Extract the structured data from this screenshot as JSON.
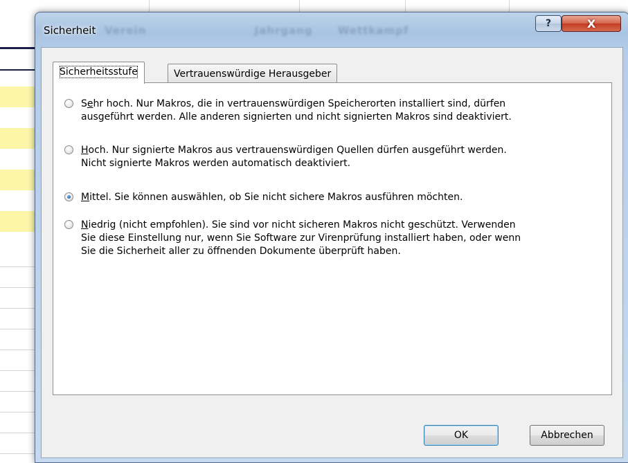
{
  "background_headers": [
    "Verein",
    "Jahrgang",
    "Wettkampf"
  ],
  "dialog": {
    "title": "Sicherheit",
    "help_glyph": "?",
    "close_glyph": "X",
    "tabs": [
      {
        "label": "Sicherheitsstufe",
        "active": true
      },
      {
        "label": "Vertrauenswürdige Herausgeber",
        "active": false
      }
    ],
    "options": [
      {
        "key_letter": "e",
        "pre": "S",
        "post": "hr hoch. Nur Makros, die in vertrauenswürdigen Speicherorten installiert sind, dürfen\nausgeführt werden. Alle anderen signierten und nicht signierten Makros sind deaktiviert.",
        "checked": false
      },
      {
        "key_letter": "H",
        "pre": "",
        "post": "och. Nur signierte Makros aus vertrauenswürdigen Quellen dürfen ausgeführt werden.\nNicht signierte Makros werden automatisch deaktiviert.",
        "checked": false
      },
      {
        "key_letter": "M",
        "pre": "",
        "post": "ittel. Sie können auswählen, ob Sie nicht sichere Makros ausführen möchten.",
        "checked": true
      },
      {
        "key_letter": "N",
        "pre": "",
        "post": "iedrig (nicht empfohlen). Sie sind vor nicht sicheren Makros nicht geschützt. Verwenden\nSie diese Einstellung nur, wenn Sie Software zur Virenprüfung installiert haben, oder wenn\nSie die Sicherheit aller zu öffnenden Dokumente überprüft haben.",
        "checked": false
      }
    ],
    "ok_label": "OK",
    "cancel_label": "Abbrechen"
  },
  "colors": {
    "highlight_rows": "#fdf6a8",
    "radio_selected": "#1b62b6",
    "close_button": "#c23b22"
  }
}
